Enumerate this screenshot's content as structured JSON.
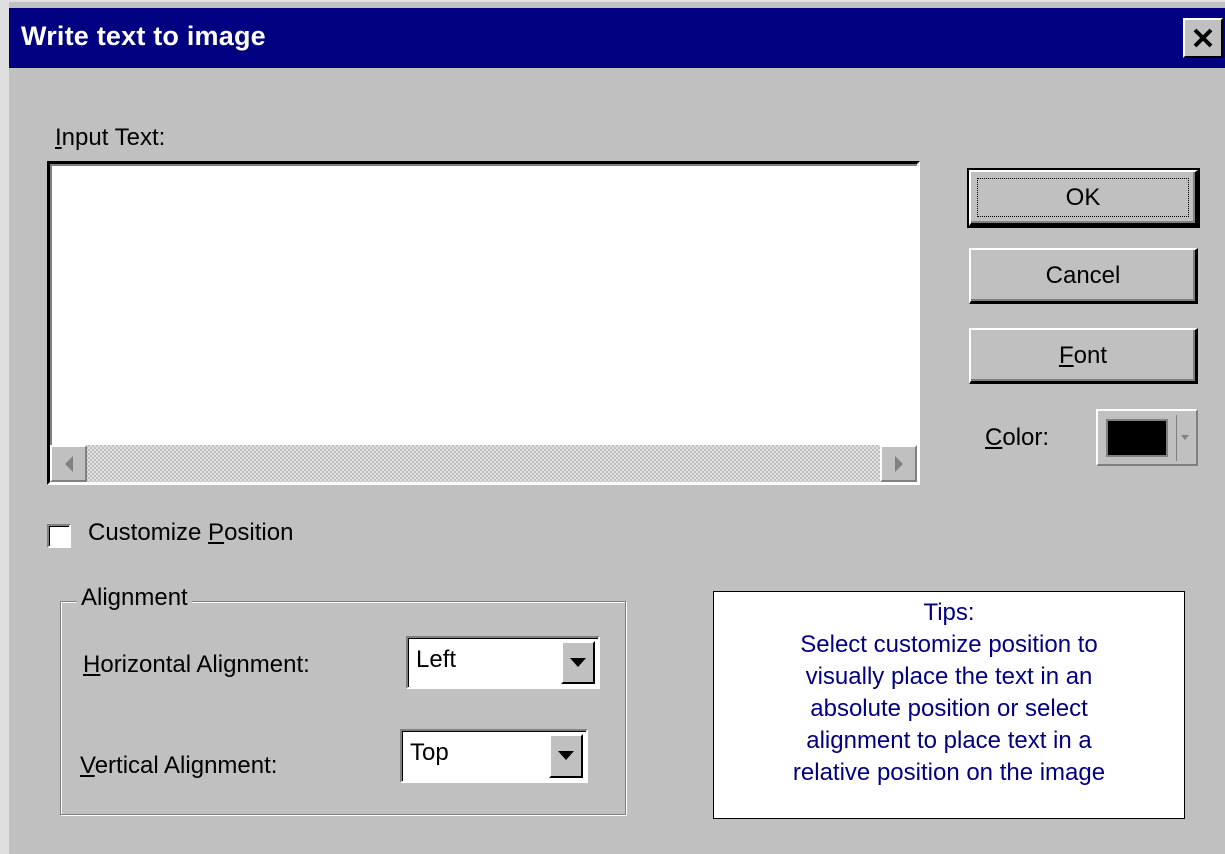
{
  "window": {
    "title": "Write text to image",
    "close_glyph": "close-icon"
  },
  "input_text": {
    "label_mnemonic": "I",
    "label_rest": "nput Text:",
    "value": ""
  },
  "buttons": {
    "ok": "OK",
    "cancel": "Cancel",
    "font_mnemonic": "F",
    "font_rest": "ont"
  },
  "color": {
    "label_mnemonic": "C",
    "label_rest": "olor:",
    "value": "#000000"
  },
  "customize_position": {
    "label_pre": "Customize ",
    "label_mnemonic": "P",
    "label_rest": "osition",
    "checked": false
  },
  "alignment": {
    "group_label": "Alignment",
    "horizontal": {
      "label_mnemonic": "H",
      "label_rest": "orizontal Alignment:",
      "value": "Left"
    },
    "vertical": {
      "label_mnemonic": "V",
      "label_rest": "ertical Alignment:",
      "value": "Top"
    }
  },
  "tips": {
    "heading": "Tips:",
    "lines": [
      "Select customize position to",
      "visually place the text in an",
      "absolute position or select",
      "alignment to place text in a",
      "relative position on the image"
    ]
  },
  "colors": {
    "titlebar": "#000080",
    "dialog_face": "#c0c0c0",
    "tips_text": "#000080"
  }
}
